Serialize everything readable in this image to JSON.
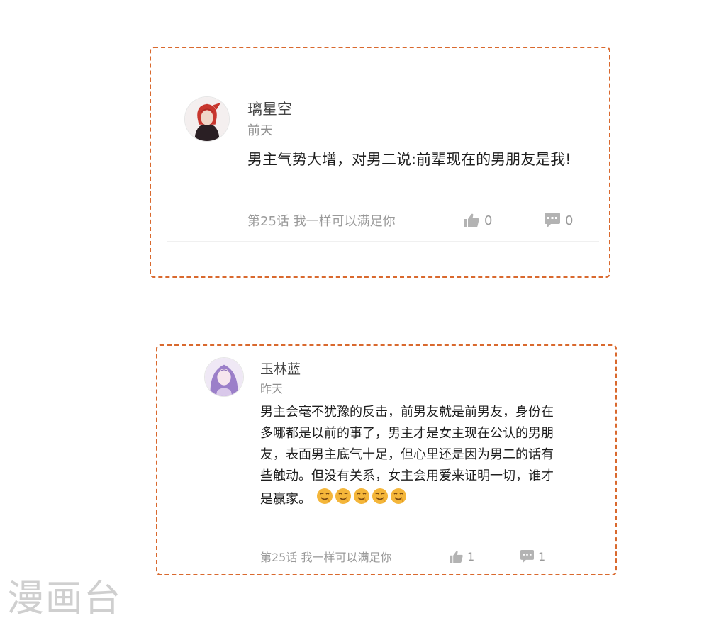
{
  "comments": [
    {
      "username": "璃星空",
      "time": "前天",
      "content": "男主气势大增，对男二说:前辈现在的男朋友是我!",
      "emojis": [],
      "chapter": "第25话 我一样可以满足你",
      "likes": "0",
      "replies": "0",
      "avatar_colors": {
        "bg": "#2a1f24",
        "hair": "#c8362e",
        "skin": "#f0d7c8"
      }
    },
    {
      "username": "玉林蓝",
      "time": "昨天",
      "content": "男主会毫不犹豫的反击，前男友就是前男友，身份在多哪都是以前的事了，男主才是女主现在公认的男朋友，表面男主底气十足，但心里还是因为男二的话有些触动。但没有关系，女主会用爱来证明一切，谁才是赢家。",
      "emojis": [
        "drooling-emoji",
        "drooling-emoji",
        "drooling-emoji",
        "drooling-emoji",
        "drooling-emoji"
      ],
      "chapter": "第25话 我一样可以满足你",
      "likes": "1",
      "replies": "1",
      "avatar_colors": {
        "bg": "#efe8f5",
        "hair": "#9b7fc9",
        "skin": "#f6e6ee"
      }
    }
  ],
  "watermark": "漫画台",
  "colors": {
    "border": "#d9692e",
    "muted": "#9a9a9a",
    "icon": "#b3b3b3",
    "emoji": "#f4b63a"
  }
}
